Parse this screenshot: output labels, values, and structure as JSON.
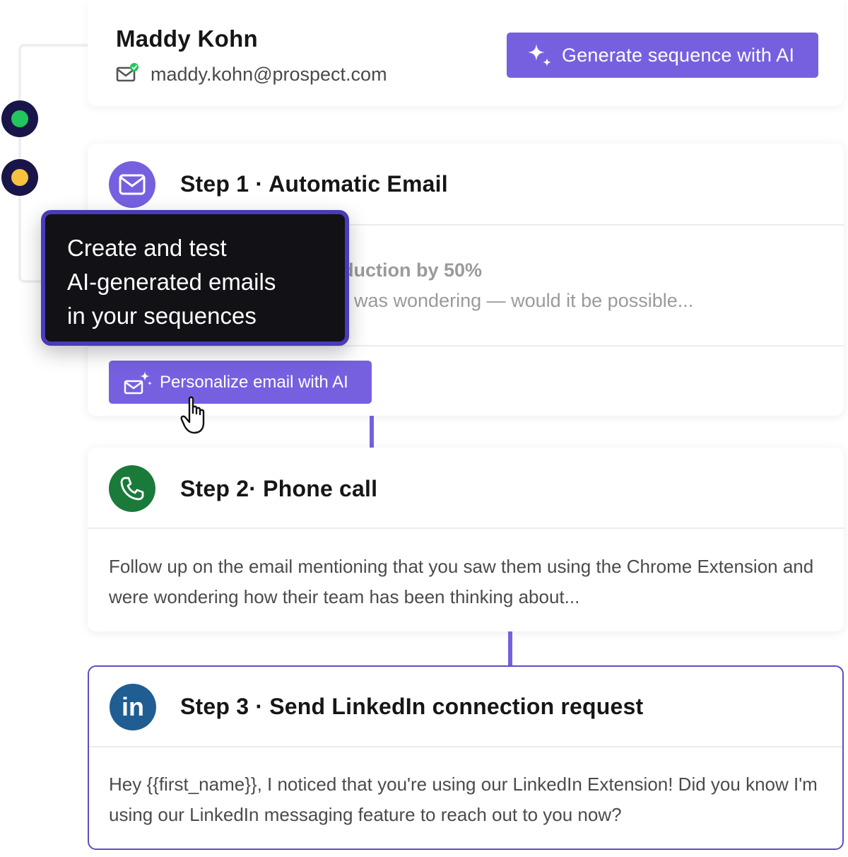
{
  "prospect": {
    "name": "Maddy Kohn",
    "email": "maddy.kohn@prospect.com"
  },
  "header": {
    "generate_button_label": "Generate sequence with AI"
  },
  "steps": [
    {
      "title": "Step 1 · Automatic Email",
      "subject_fragment": "duction by 50%",
      "body_fragment": "was wondering — would it be possible...",
      "action_button_label": "Personalize email with AI"
    },
    {
      "title": "Step 2· Phone call",
      "body": "Follow up on the email mentioning that you saw them using the Chrome Extension and were wondering how their team has been thinking about..."
    },
    {
      "title": "Step 3 · Send LinkedIn connection request",
      "body": "Hey {{first_name}}, I noticed that you're using our LinkedIn Extension! Did you know I'm using our LinkedIn messaging feature to reach out to you now?",
      "icon_text": "in"
    }
  ],
  "tooltip": {
    "lines": [
      "Create and test",
      "AI-generated emails",
      "in your sequences"
    ]
  },
  "status_dots": [
    "green",
    "yellow"
  ],
  "icons": [
    "mail-verified-icon",
    "sparkle-icon",
    "mail-icon",
    "mail-sparkle-icon",
    "pointer-hand-icon",
    "phone-icon",
    "linkedin-icon"
  ],
  "colors": {
    "accent": "#7660e0",
    "dark_navy": "#1a1549",
    "green_dot": "#22c55e",
    "yellow_dot": "#f7c33f",
    "phone_green": "#1a7a3a",
    "linkedin_blue": "#1f5d92"
  }
}
